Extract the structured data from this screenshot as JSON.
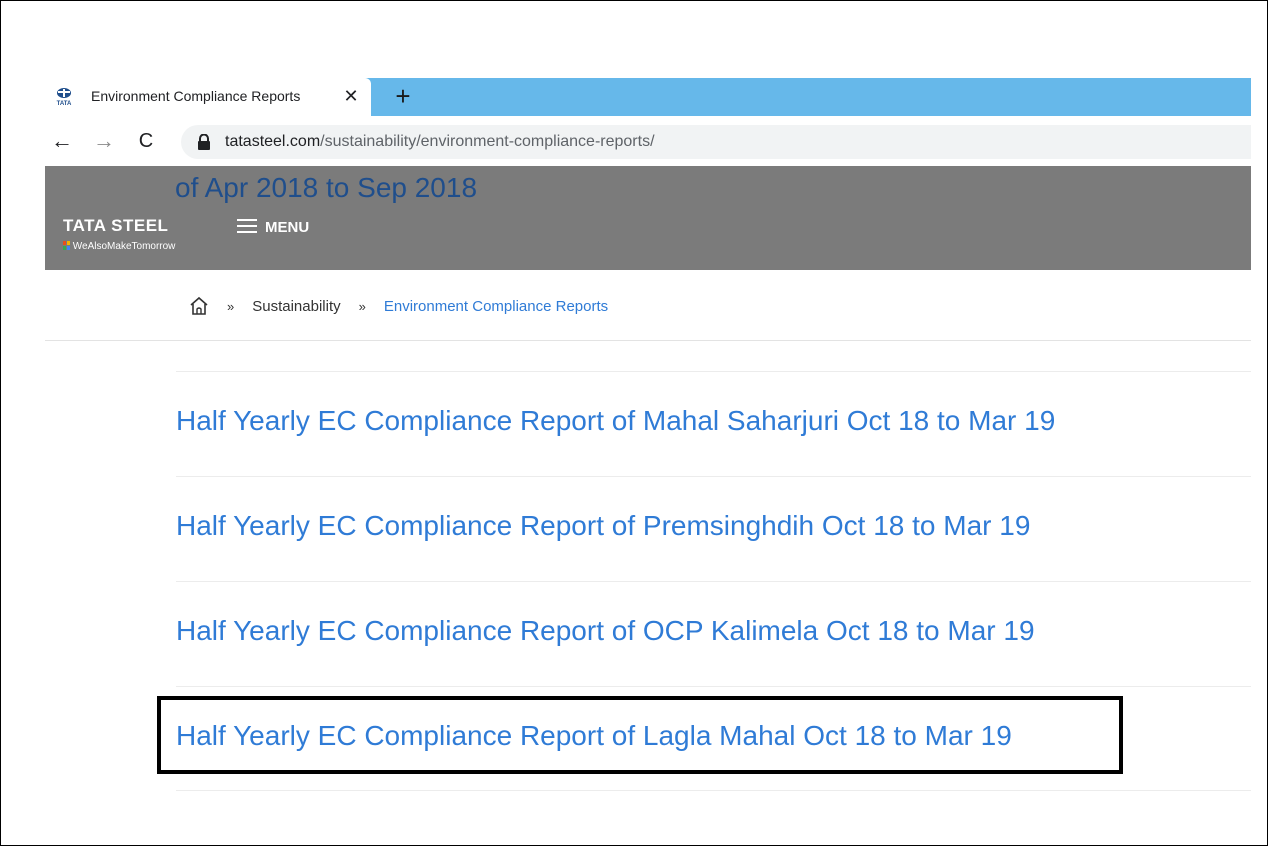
{
  "browser": {
    "tab_title": "Environment Compliance Reports",
    "tab_close": "✕",
    "new_tab": "+",
    "url_host": "tatasteel.com",
    "url_path": "/sustainability/environment-compliance-reports/",
    "back": "←",
    "forward": "→",
    "reload": "C"
  },
  "header": {
    "behind_title": "of Apr 2018 to Sep 2018",
    "brand": "TATA STEEL",
    "tagline": "WeAlsoMakeTomorrow",
    "menu_label": "MENU"
  },
  "breadcrumb": {
    "sep": "»",
    "items": [
      "Sustainability",
      "Environment Compliance Reports"
    ]
  },
  "reports": [
    "Half Yearly EC Compliance Report of Mahal Saharjuri Oct 18 to Mar 19",
    "Half Yearly EC Compliance Report of Premsinghdih Oct 18 to Mar 19",
    "Half Yearly EC Compliance Report of OCP Kalimela Oct 18 to Mar 19",
    "Half Yearly EC Compliance Report of Lagla Mahal Oct 18 to Mar 19"
  ],
  "colors": {
    "tabstrip": "#66b8ea",
    "header_bg": "#7b7b7b",
    "link": "#2f7bd6"
  }
}
